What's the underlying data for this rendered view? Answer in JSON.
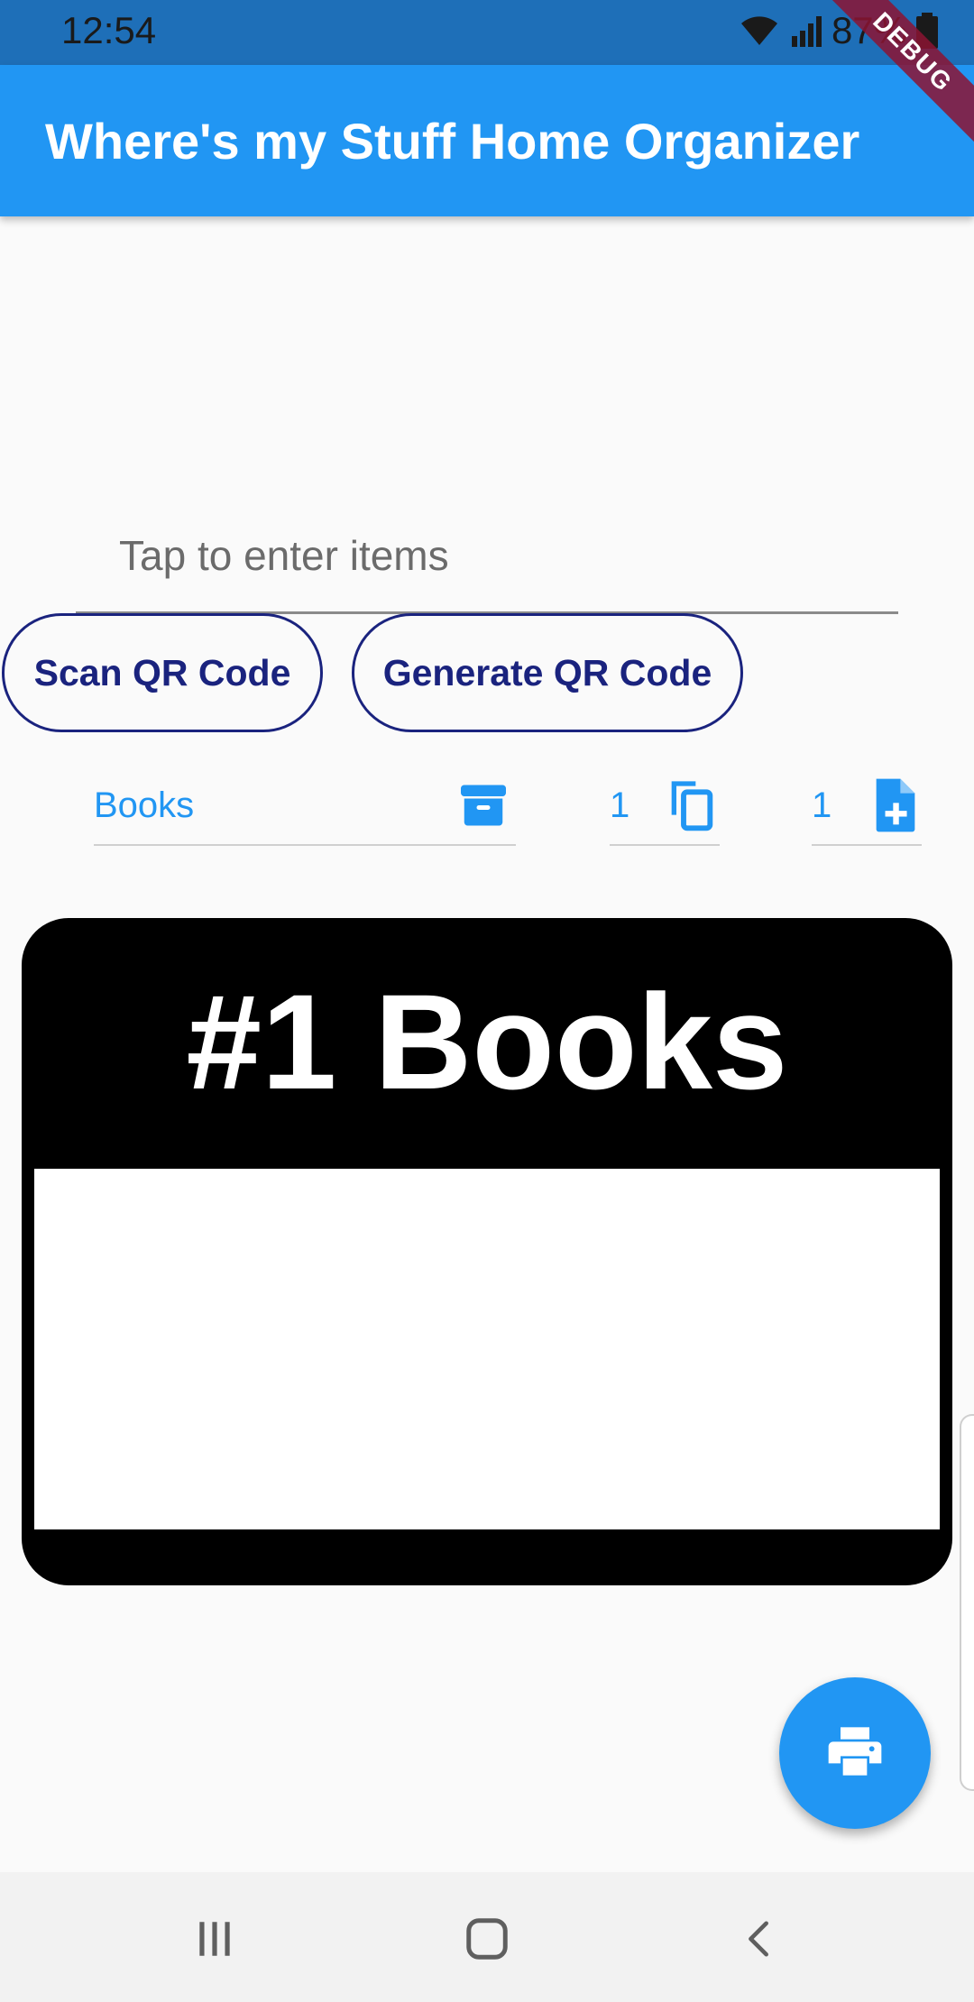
{
  "status_bar": {
    "time": "12:54",
    "battery": "87%"
  },
  "app_bar": {
    "title": "Where's my Stuff Home Organizer"
  },
  "debug_banner": "DEBUG",
  "items_input": {
    "placeholder": "Tap to enter items",
    "value": ""
  },
  "buttons": {
    "scan": "Scan QR Code",
    "generate": "Generate QR Code"
  },
  "fields": {
    "box_name": "Books",
    "copies": "1",
    "pages": "1"
  },
  "label_preview": {
    "title": "#1 Books"
  },
  "icons": {
    "box": "archive-icon",
    "copies": "copy-icon",
    "pages": "note-add-icon",
    "fab": "print-icon"
  },
  "colors": {
    "primary": "#2196f3",
    "status_bar": "#1e6fb8",
    "button_outline": "#1a237e"
  }
}
